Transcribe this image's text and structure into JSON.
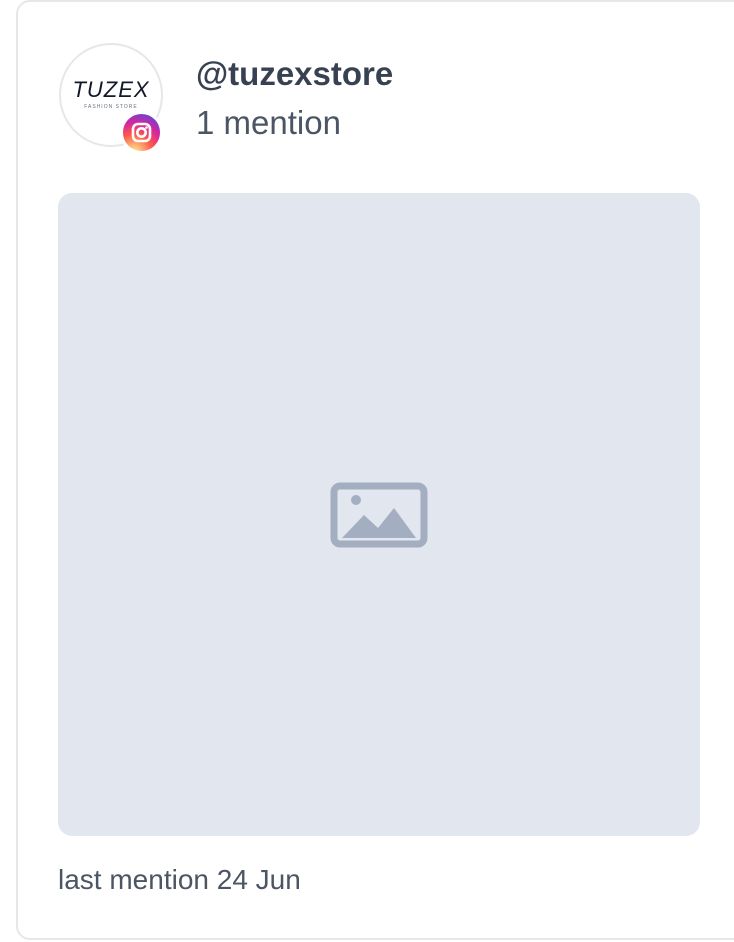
{
  "account": {
    "handle": "@tuzexstore",
    "mention_count": "1 mention",
    "platform": "instagram",
    "avatar": {
      "logo_text": "TUZEX",
      "logo_subtext": "FASHION STORE"
    }
  },
  "media": {
    "placeholder_icon": "image-placeholder-icon"
  },
  "footer": {
    "last_mention": "last mention 24 Jun"
  },
  "colors": {
    "card_border": "#e5e7eb",
    "media_background": "#e2e6ee",
    "icon_color": "#a3afc1",
    "text_primary": "#374151",
    "text_secondary": "#4b5563"
  }
}
